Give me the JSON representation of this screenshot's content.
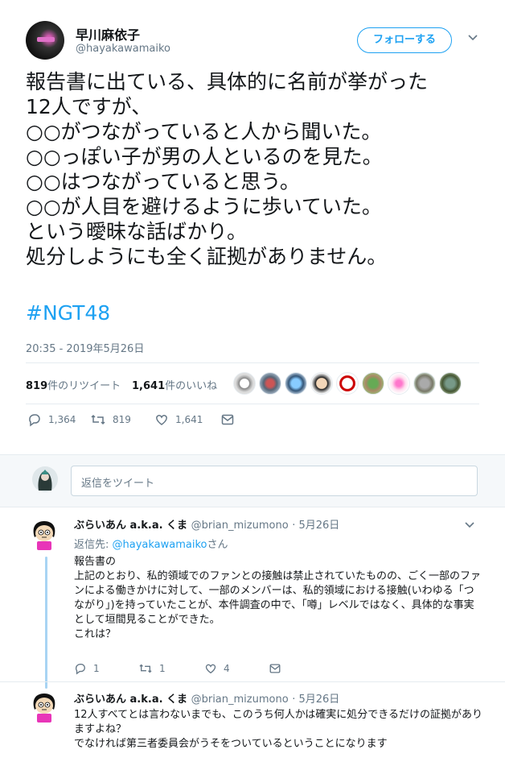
{
  "tweet": {
    "display_name": "早川麻依子",
    "screen_name": "@hayakawamaiko",
    "follow_label": "フォローする",
    "text": "報告書に出ている、具体的に名前が挙がった\n12人ですが、\n○○がつながっていると人から聞いた。\n○○っぽい子が男の人といるのを見た。\n○○はつながっていると思う。\n○○が人目を避けるように歩いていた。\nという曖昧な話ばかり。\n処分しようにも全く証拠がありません。",
    "hashtag": "#NGT48",
    "timestamp": "20:35 - 2019年5月26日",
    "retweets_count": "819",
    "retweets_label": "件のリツイート",
    "likes_count": "1,641",
    "likes_label": "件のいいね",
    "actions": {
      "replies": "1,364",
      "retweets": "819",
      "likes": "1,641"
    }
  },
  "reply_box": {
    "placeholder": "返信をツイート"
  },
  "replies": [
    {
      "name": "ぶらいあん a.k.a. くま",
      "handle": "@brian_mizumono",
      "time": "· 5月26日",
      "reply_to_prefix": "返信先: ",
      "reply_to_handle": "@hayakawamaiko",
      "reply_to_suffix": "さん",
      "text": "報告書の\n上記のとおり、私的領域でのファンとの接触は禁止されていたものの、ごく一部のファンによる働きかけに対して、一部のメンバーは、私的領域における接触(いわゆる「つながり」)を持っていたことが、本件調査の中で、「噂」レベルではなく、具体的な事実として垣間見ることができた。\nこれは？",
      "actions": {
        "replies": "1",
        "retweets": "1",
        "likes": "4"
      }
    },
    {
      "name": "ぶらいあん a.k.a. くま",
      "handle": "@brian_mizumono",
      "time": "· 5月26日",
      "text": "12人すべてとは言わないまでも、このうち何人かは確実に処分できるだけの証拠がありますよね？\nでなければ第三者委員会がうそをついているということになります"
    }
  ],
  "colors": {
    "accent": "#1da1f2",
    "secondary_text": "#657786",
    "border": "#e6ecf0",
    "thread_line": "#a8d4f3"
  },
  "icons": [
    "caret-down-icon",
    "reply-icon",
    "retweet-icon",
    "like-icon",
    "dm-icon"
  ]
}
